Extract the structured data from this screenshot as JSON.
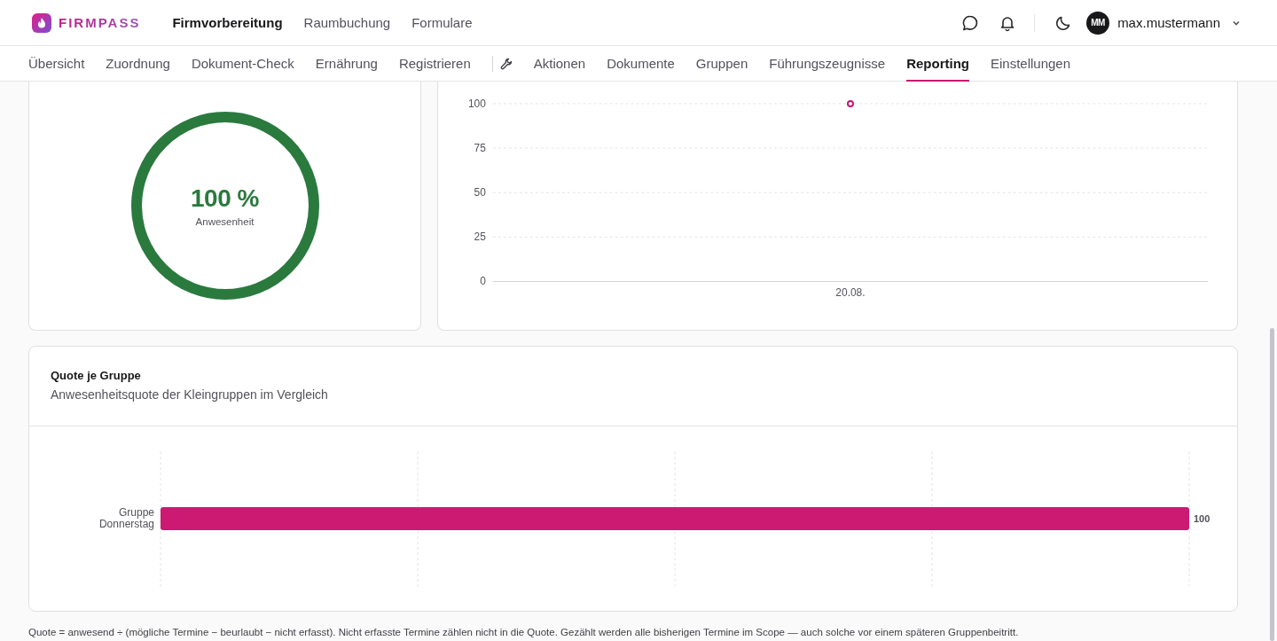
{
  "header": {
    "brand": "FIRMPASS",
    "nav": [
      {
        "label": "Firmvorbereitung",
        "selected": true
      },
      {
        "label": "Raumbuchung",
        "selected": false
      },
      {
        "label": "Formulare",
        "selected": false
      }
    ],
    "user": {
      "initials": "MM",
      "name": "max.mustermann"
    }
  },
  "subnav": [
    {
      "kind": "tab",
      "label": "Übersicht",
      "selected": false
    },
    {
      "kind": "tab",
      "label": "Zuordnung",
      "selected": false
    },
    {
      "kind": "tab",
      "label": "Dokument-Check",
      "selected": false
    },
    {
      "kind": "tab",
      "label": "Ernährung",
      "selected": false
    },
    {
      "kind": "tab",
      "label": "Registrieren",
      "selected": false
    },
    {
      "kind": "tools"
    },
    {
      "kind": "tab",
      "label": "Aktionen",
      "selected": false
    },
    {
      "kind": "tab",
      "label": "Dokumente",
      "selected": false
    },
    {
      "kind": "tab",
      "label": "Gruppen",
      "selected": false
    },
    {
      "kind": "tab",
      "label": "Führungszeugnisse",
      "selected": false
    },
    {
      "kind": "tab",
      "label": "Reporting",
      "selected": true
    },
    {
      "kind": "tab",
      "label": "Einstellungen",
      "selected": false
    }
  ],
  "attendance": {
    "value": "100 %",
    "label": "Anwesenheit",
    "level": 1
  },
  "trend": {
    "chart_data": {
      "type": "line",
      "categories": [
        "20.08."
      ],
      "series": [
        {
          "color": "#c8186f",
          "marker": "circle",
          "values": [
            100
          ]
        }
      ],
      "ylim": [
        0,
        100
      ],
      "yticks": [
        0,
        25,
        50,
        75,
        100
      ],
      "grid": true
    }
  },
  "groups": {
    "title": "Quote je Gruppe",
    "subtitle": "Anwesenheitsquote der Kleingruppen im Vergleich",
    "chart_data": {
      "type": "bar",
      "orientation": "horizontal",
      "categories": [
        "Gruppe Donnerstag"
      ],
      "values": [
        100
      ],
      "grid": true,
      "data_labels": true
    }
  },
  "footnote": "Quote = anwesend ÷ (mögliche Termine − beurlaubt − nicht erfasst). Nicht erfasste Termine zählen nicht in die Quote. Gezählt werden alle bisherigen Termine im Scope — auch solche vor einem späteren Gruppenbeitritt."
}
